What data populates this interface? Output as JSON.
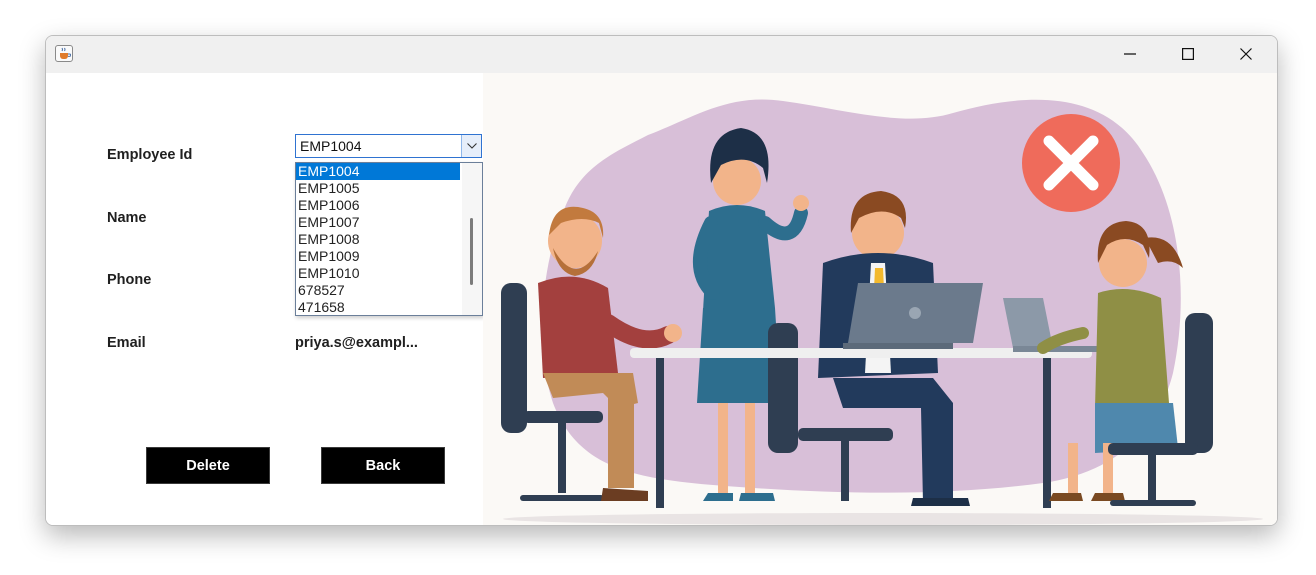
{
  "window": {
    "controls": {
      "minimize_icon": "minimize-icon",
      "maximize_icon": "maximize-icon",
      "close_icon": "close-icon"
    },
    "app_icon": "java-cup-icon"
  },
  "form": {
    "employee_id_label": "Employee Id",
    "name_label": "Name",
    "phone_label": "Phone",
    "email_label": "Email",
    "email_value": "priya.s@exampl...",
    "employee_id_combo": {
      "selected": "EMP1004",
      "options": [
        "EMP1004",
        "EMP1005",
        "EMP1006",
        "EMP1007",
        "EMP1008",
        "EMP1009",
        "EMP1010",
        "678527",
        "471658"
      ],
      "highlighted_option": "EMP1004"
    }
  },
  "buttons": {
    "delete_label": "Delete",
    "back_label": "Back"
  },
  "illustration": {
    "description_icons": [
      "error-x-icon",
      "laptop-icon"
    ],
    "colors": {
      "blob": "#d8bfd8",
      "error_badge": "#ef6b5b",
      "table_top": "#efefef"
    }
  }
}
